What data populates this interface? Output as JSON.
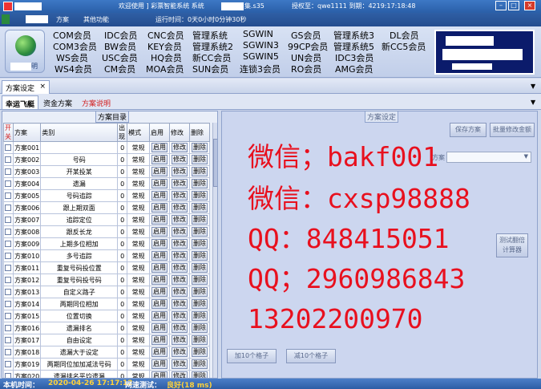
{
  "titlebar": {
    "left_text": "欢迎使用 ] 彩票智能系统 系统",
    "mid_text": "集.s35",
    "right_text": "授权至：qwe1111  到期：4219:17:18:48"
  },
  "menubar": {
    "items": [
      "方案",
      "其他功能"
    ],
    "runtime": "运行时间：0天0小时0分钟30秒"
  },
  "members": {
    "row1": [
      "COM会员",
      "IDC会员",
      "CNC会员",
      "管理系统",
      "SGWIN",
      "GS会员",
      "管理系统3",
      "DL会员"
    ],
    "row2": [
      "COM3会员",
      "BW会员",
      "KEY会员",
      "管理系统2",
      "SGWIN3",
      "99CP会员",
      "管理系统5",
      "新CC5会员"
    ],
    "row3": [
      "WS会员",
      "USC会员",
      "HQ会员",
      "新CC会员",
      "SGWIN5",
      "UN会员",
      "IDC3会员"
    ],
    "row4": [
      "WS4会员",
      "CM会员",
      "MOA会员",
      "SUN会员",
      "连锁3会员",
      "RO会员",
      "AMG会员"
    ],
    "big_label": "明"
  },
  "tab": {
    "label": "方案设定",
    "close": "×"
  },
  "subtabs": [
    "幸运飞艇",
    "资金方案",
    "方案说明"
  ],
  "left": {
    "group_title": "方案目录",
    "headers": [
      "开关",
      "方案",
      "类别",
      "出现",
      "模式",
      "启用",
      "修改",
      "删除"
    ],
    "rows": [
      {
        "name": "方案001",
        "type": "",
        "val": "0",
        "mode": "常规"
      },
      {
        "name": "方案002",
        "type": "号码",
        "val": "0",
        "mode": "常规"
      },
      {
        "name": "方案003",
        "type": "开某投某",
        "val": "0",
        "mode": "常规"
      },
      {
        "name": "方案004",
        "type": "遗漏",
        "val": "0",
        "mode": "常规"
      },
      {
        "name": "方案005",
        "type": "号码追踪",
        "val": "0",
        "mode": "常规"
      },
      {
        "name": "方案006",
        "type": "跟上期双面",
        "val": "0",
        "mode": "常规"
      },
      {
        "name": "方案007",
        "type": "追踪定位",
        "val": "0",
        "mode": "常规"
      },
      {
        "name": "方案008",
        "type": "跟反长龙",
        "val": "0",
        "mode": "常规"
      },
      {
        "name": "方案009",
        "type": "上期多位相加",
        "val": "0",
        "mode": "常规"
      },
      {
        "name": "方案010",
        "type": "多号追踪",
        "val": "0",
        "mode": "常规"
      },
      {
        "name": "方案011",
        "type": "重复号码投位置",
        "val": "0",
        "mode": "常规"
      },
      {
        "name": "方案012",
        "type": "重复号码投号码",
        "val": "0",
        "mode": "常规"
      },
      {
        "name": "方案013",
        "type": "自定义路子",
        "val": "0",
        "mode": "常规"
      },
      {
        "name": "方案014",
        "type": "两期同位相加",
        "val": "0",
        "mode": "常规"
      },
      {
        "name": "方案015",
        "type": "位置切换",
        "val": "0",
        "mode": "常规"
      },
      {
        "name": "方案016",
        "type": "遗漏排名",
        "val": "0",
        "mode": "常规"
      },
      {
        "name": "方案017",
        "type": "自由设定",
        "val": "0",
        "mode": "常规"
      },
      {
        "name": "方案018",
        "type": "遗漏大于设定",
        "val": "0",
        "mode": "常规"
      },
      {
        "name": "方案019",
        "type": "两期同位加加减法号码",
        "val": "0",
        "mode": "常规"
      },
      {
        "name": "方案020",
        "type": "遗漏排名平均遗漏",
        "val": "0",
        "mode": "常规"
      }
    ],
    "enable_label": "启用",
    "edit_label": "修改",
    "delete_label": "删除"
  },
  "right": {
    "group_title": "方案设定",
    "save_btn": "保存方案",
    "batch_btn": "批量修改金额",
    "select_prefix": "方案",
    "side_btn": "测试翻倍\n计算器",
    "add_btn": "加10个格子",
    "sub_btn": "减10个格子",
    "promo": [
      "微信；bakf001",
      "微信：cxsp98888",
      "QQ：848415051",
      "QQ；2960986843",
      "13202200970"
    ],
    "promo_color": "#e8101e"
  },
  "status": {
    "time_label": "本机时间：",
    "time_value": "2020-04-26 17:17:12",
    "net_label": "网速测试：",
    "net_value": "良好(18 ms)"
  }
}
